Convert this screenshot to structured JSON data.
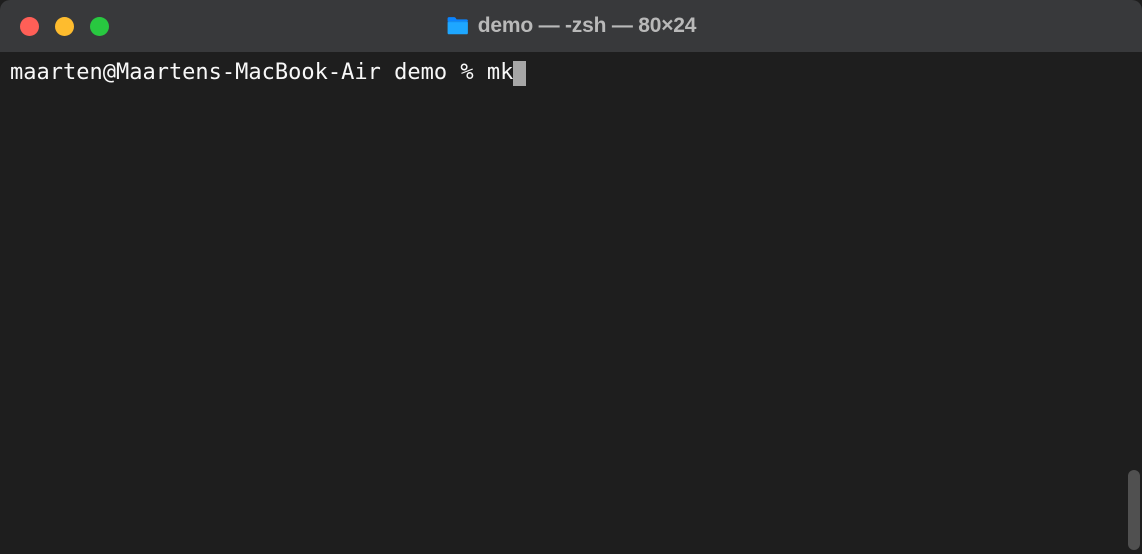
{
  "window": {
    "title": "demo — -zsh — 80×24",
    "traffic_lights": {
      "close": "#ff5f57",
      "minimize": "#febc2e",
      "maximize": "#28c840"
    },
    "icon": "folder-icon"
  },
  "terminal": {
    "prompt": "maarten@Maartens-MacBook-Air demo % ",
    "command": "mk",
    "size": "80×24",
    "shell": "-zsh",
    "cwd": "demo",
    "user": "maarten",
    "host": "Maartens-MacBook-Air"
  }
}
